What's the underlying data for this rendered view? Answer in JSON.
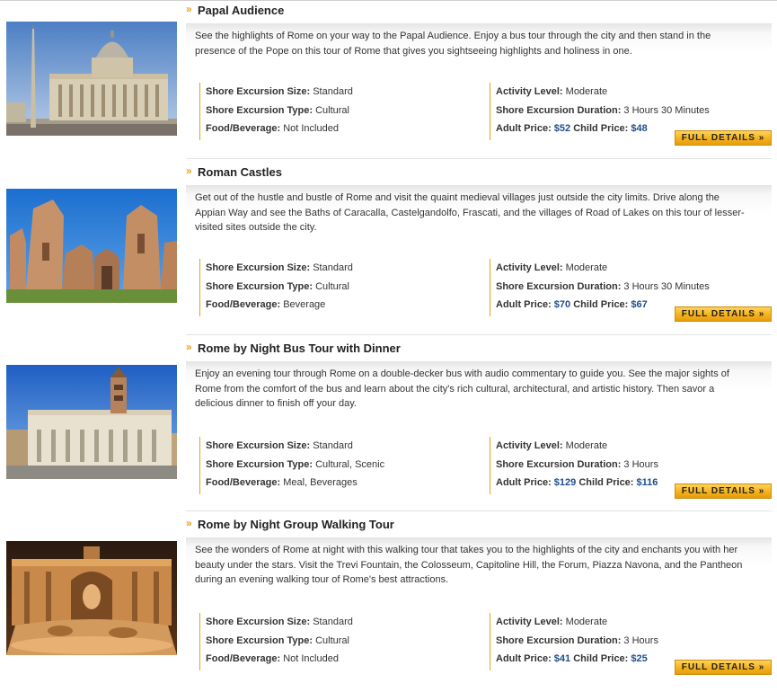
{
  "excursions": [
    {
      "title": "Papal Audience",
      "description": "See the highlights of Rome on your way to the Papal Audience. Enjoy a bus tour through the city and then stand in the presence of the Pope on this tour of Rome that gives you sightseeing highlights and holiness in one.",
      "size_label": "Shore Excursion Size:",
      "size": "Standard",
      "type_label": "Shore Excursion Type:",
      "type": "Cultural",
      "food_label": "Food/Beverage:",
      "food": "Not Included",
      "activity_label": "Activity Level:",
      "activity": "Moderate",
      "duration_label": "Shore Excursion Duration:",
      "duration": "3 Hours 30 Minutes",
      "adult_label": "Adult Price:",
      "adult_price": "$52",
      "child_label": "Child Price:",
      "child_price": "$48",
      "button": "FULL DETAILS",
      "image_icon": "st-peters-basilica-photo"
    },
    {
      "title": "Roman Castles",
      "description": "Get out of the hustle and bustle of Rome and visit the quaint medieval villages just outside the city limits. Drive along the Appian Way and see the Baths of Caracalla, Castelgandolfo, Frascati, and the villages of Road of Lakes on this tour of lesser-visited sites outside the city.",
      "size_label": "Shore Excursion Size:",
      "size": "Standard",
      "type_label": "Shore Excursion Type:",
      "type": "Cultural",
      "food_label": "Food/Beverage:",
      "food": "Beverage",
      "activity_label": "Activity Level:",
      "activity": "Moderate",
      "duration_label": "Shore Excursion Duration:",
      "duration": "3 Hours 30 Minutes",
      "adult_label": "Adult Price:",
      "adult_price": "$70",
      "child_label": "Child Price:",
      "child_price": "$67",
      "button": "FULL DETAILS",
      "image_icon": "baths-of-caracalla-photo"
    },
    {
      "title": "Rome by Night Bus Tour with Dinner",
      "description": "Enjoy an evening tour through Rome on a double-decker bus with audio commentary to guide you. See the major sights of Rome from the comfort of the bus and learn about the city's rich cultural, architectural, and artistic history. Then savor a delicious dinner to finish off your day.",
      "size_label": "Shore Excursion Size:",
      "size": "Standard",
      "type_label": "Shore Excursion Type:",
      "type": "Cultural, Scenic",
      "food_label": "Food/Beverage:",
      "food": "Meal, Beverages",
      "activity_label": "Activity Level:",
      "activity": "Moderate",
      "duration_label": "Shore Excursion Duration:",
      "duration": "3 Hours",
      "adult_label": "Adult Price:",
      "adult_price": "$129",
      "child_label": "Child Price:",
      "child_price": "$116",
      "button": "FULL DETAILS",
      "image_icon": "santa-maria-maggiore-photo"
    },
    {
      "title": "Rome by Night Group Walking Tour",
      "description": "See the wonders of Rome at night with this walking tour that takes you to the highlights of the city and enchants you with her beauty under the stars. Visit the Trevi Fountain, the Colosseum, Capitoline Hill, the Forum, Piazza Navona, and the Pantheon during an evening walking tour of Rome's best attractions.",
      "size_label": "Shore Excursion Size:",
      "size": "Standard",
      "type_label": "Shore Excursion Type:",
      "type": "Cultural",
      "food_label": "Food/Beverage:",
      "food": "Not Included",
      "activity_label": "Activity Level:",
      "activity": "Moderate",
      "duration_label": "Shore Excursion Duration:",
      "duration": "3 Hours",
      "adult_label": "Adult Price:",
      "adult_price": "$41",
      "child_label": "Child Price:",
      "child_price": "$25",
      "button": "FULL DETAILS",
      "image_icon": "trevi-fountain-night-photo"
    }
  ],
  "icons": {
    "title_marker": "»",
    "button_arrow": "»"
  },
  "colors": {
    "accent": "#e8a117",
    "price": "#1d4f8a",
    "button": "#f4b21c"
  }
}
